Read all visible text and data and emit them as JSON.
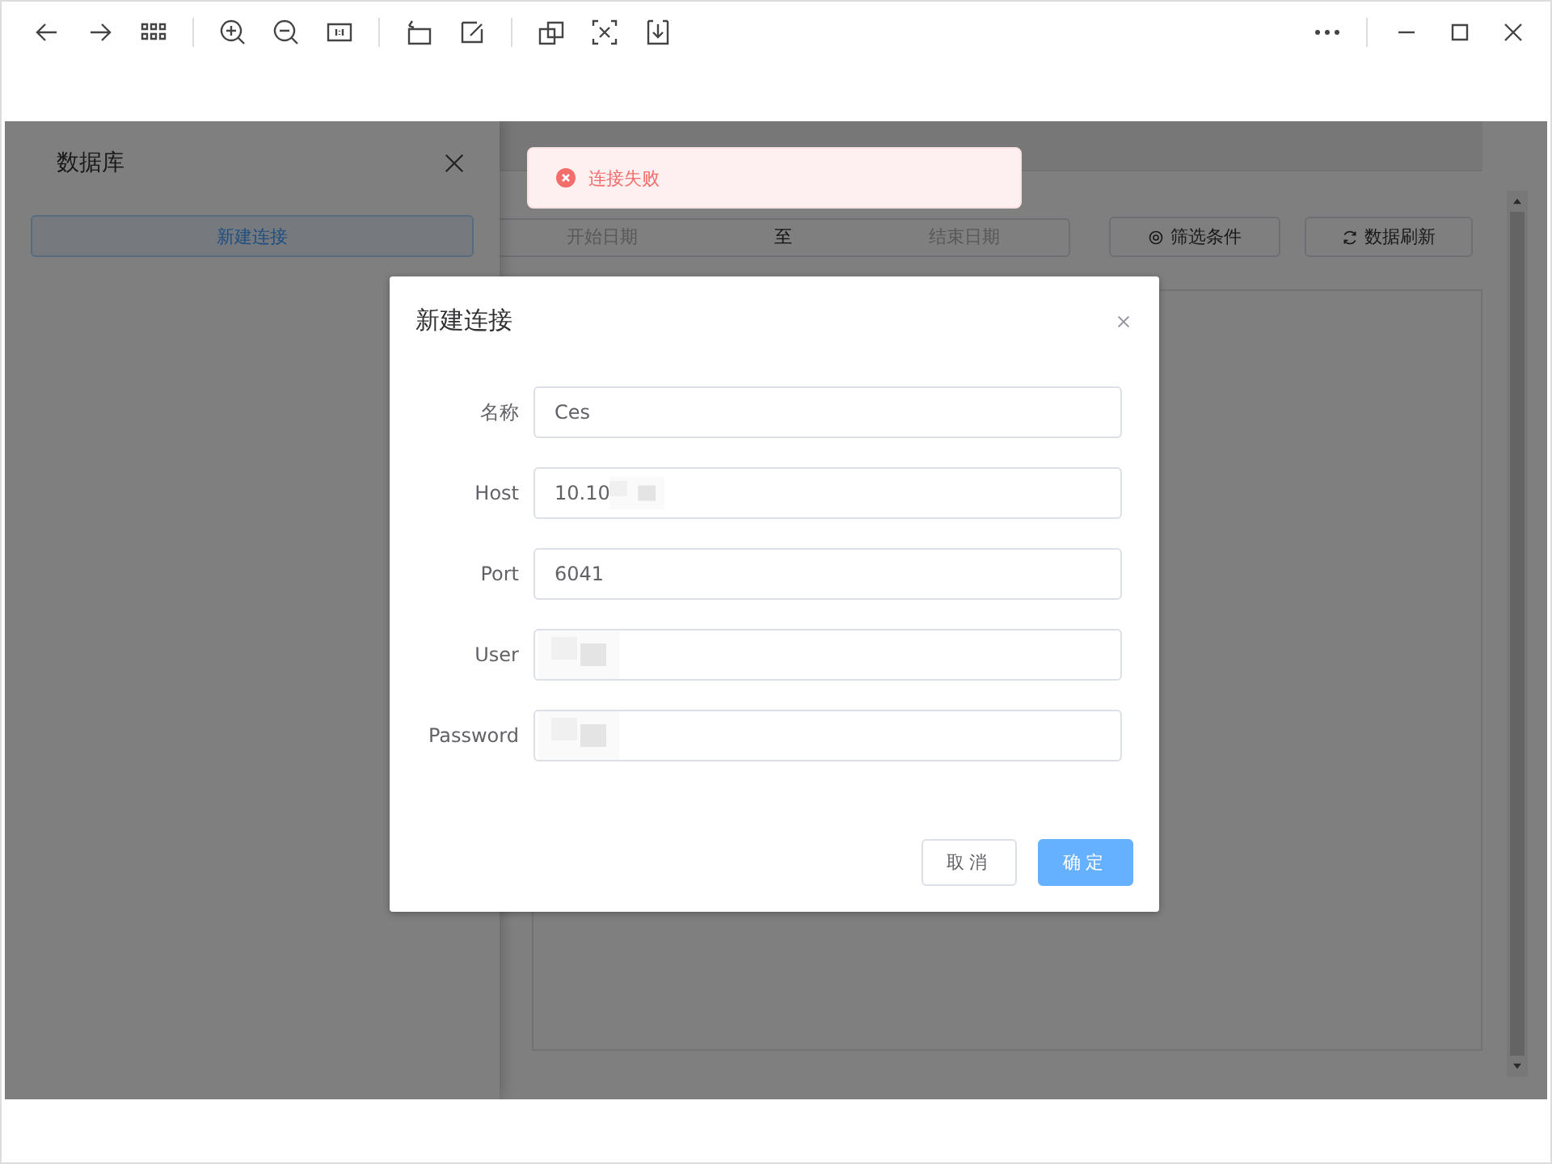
{
  "app": {
    "drawer": {
      "title": "数据库",
      "new_button": "新建连接"
    },
    "filter_bar": {
      "start_placeholder": "开始日期",
      "separator": "至",
      "end_placeholder": "结束日期",
      "filter_button": "筛选条件",
      "refresh_button": "数据刷新"
    },
    "toast": {
      "kind": "error",
      "message": "连接失败"
    },
    "dialog": {
      "title": "新建连接",
      "fields": [
        {
          "label": "名称",
          "value": "Ces",
          "redacted": false
        },
        {
          "label": "Host",
          "value": "10.10",
          "redacted": true
        },
        {
          "label": "Port",
          "value": "6041",
          "redacted": false
        },
        {
          "label": "User",
          "redacted": true
        },
        {
          "label": "Password",
          "redacted": true
        }
      ],
      "buttons": [
        {
          "label": "取消",
          "kind": "default"
        },
        {
          "label": "确定",
          "kind": "primary"
        }
      ]
    }
  }
}
